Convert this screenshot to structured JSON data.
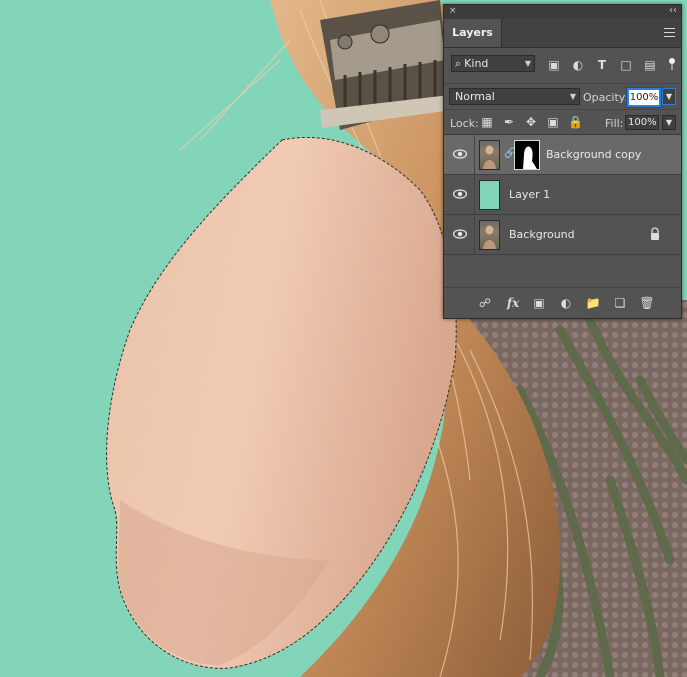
{
  "panel": {
    "tab_label": "Layers",
    "close_glyph": "×",
    "collapse_glyph": "‹‹"
  },
  "filter": {
    "kind_label": "Kind",
    "icons": [
      "image-filter-icon",
      "adjustment-filter-icon",
      "type-filter-icon",
      "shape-filter-icon",
      "smart-object-filter-icon"
    ]
  },
  "blend": {
    "mode": "Normal",
    "opacity_label": "Opacity:",
    "opacity_value": "100%"
  },
  "lock": {
    "label": "Lock:",
    "fill_label": "Fill:",
    "fill_value": "100%"
  },
  "layers": [
    {
      "name": "Background copy",
      "selected": true,
      "thumb": "photo",
      "has_mask": true,
      "locked": false
    },
    {
      "name": "Layer 1",
      "selected": false,
      "thumb": "solid",
      "color": "#83d5b9",
      "has_mask": false,
      "locked": false
    },
    {
      "name": "Background",
      "selected": false,
      "thumb": "photo",
      "has_mask": false,
      "locked": true
    }
  ],
  "footer_icons": [
    "link-layers-icon",
    "fx-icon",
    "add-mask-icon",
    "adjustment-layer-icon",
    "group-folder-icon",
    "new-layer-icon",
    "trash-icon"
  ],
  "colors": {
    "canvas_background": "#83d5b9",
    "panel_background": "#535353",
    "selected_row": "#696969",
    "accent": "#2e7dd9"
  }
}
